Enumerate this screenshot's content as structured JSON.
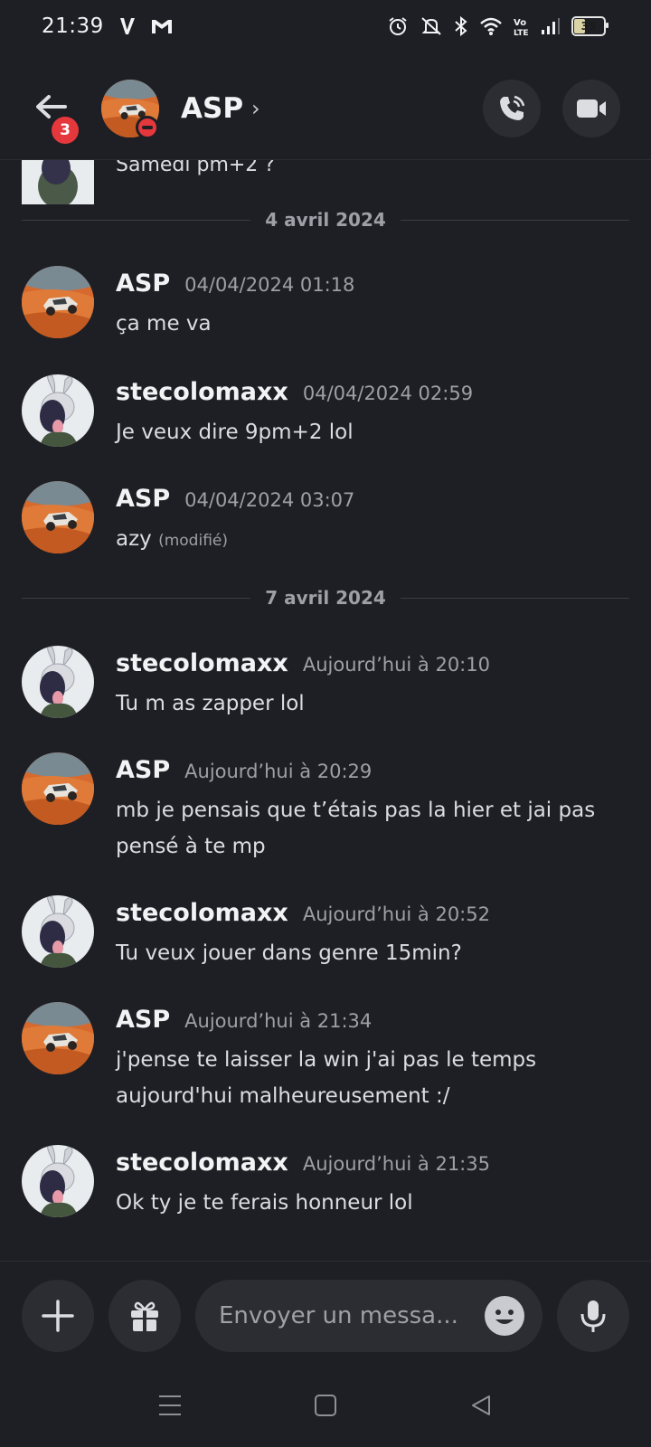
{
  "status_bar": {
    "time": "21:39",
    "battery_level": "35",
    "app_icons": [
      "v-app-icon",
      "gmail-icon"
    ],
    "system_icons": [
      "alarm-icon",
      "mute-icon",
      "bluetooth-icon",
      "wifi-icon",
      "volte-icon",
      "signal-icon",
      "battery-icon"
    ]
  },
  "header": {
    "back_badge": "3",
    "title": "ASP",
    "status": "do-not-disturb"
  },
  "partial_message": {
    "text": "Samedi pm+2 ?"
  },
  "messages": [
    {
      "type": "divider",
      "label": "4 avril 2024"
    },
    {
      "type": "message",
      "author": "ASP",
      "time": "04/04/2024 01:18",
      "lines": [
        "ça me va"
      ],
      "avatar": "desert-car"
    },
    {
      "type": "message",
      "author": "stecolomaxx",
      "time": "04/04/2024 02:59",
      "lines": [
        "Je veux dire 9pm+2 lol"
      ],
      "avatar": "bunny-ears"
    },
    {
      "type": "message",
      "author": "ASP",
      "time": "04/04/2024 03:07",
      "lines": [
        "azy"
      ],
      "edited": "(modifié)",
      "avatar": "desert-car"
    },
    {
      "type": "divider",
      "label": "7 avril 2024"
    },
    {
      "type": "message",
      "author": "stecolomaxx",
      "time": "Aujourd’hui à 20:10",
      "lines": [
        "Tu m as zapper lol"
      ],
      "avatar": "bunny-ears"
    },
    {
      "type": "message",
      "author": "ASP",
      "time": "Aujourd’hui à 20:29",
      "lines": [
        "mb je pensais que t’étais pas la hier et jai pas",
        "pensé à te mp"
      ],
      "avatar": "desert-car"
    },
    {
      "type": "message",
      "author": "stecolomaxx",
      "time": "Aujourd’hui à 20:52",
      "lines": [
        "Tu veux jouer dans genre 15min?"
      ],
      "avatar": "bunny-ears"
    },
    {
      "type": "message",
      "author": "ASP",
      "time": "Aujourd’hui à 21:34",
      "lines": [
        "j'pense te laisser la win j'ai pas le temps",
        "aujourd'hui malheureusement :/"
      ],
      "avatar": "desert-car"
    },
    {
      "type": "message",
      "author": "stecolomaxx",
      "time": "Aujourd’hui à 21:35",
      "lines": [
        "Ok ty je te ferais honneur lol"
      ],
      "avatar": "bunny-ears"
    }
  ],
  "composer": {
    "placeholder": "Envoyer un messa..."
  },
  "colors": {
    "background": "#1e1f24",
    "button_bg": "#2b2d33",
    "badge_red": "#e5383d",
    "muted_text": "#9ea0a7"
  }
}
